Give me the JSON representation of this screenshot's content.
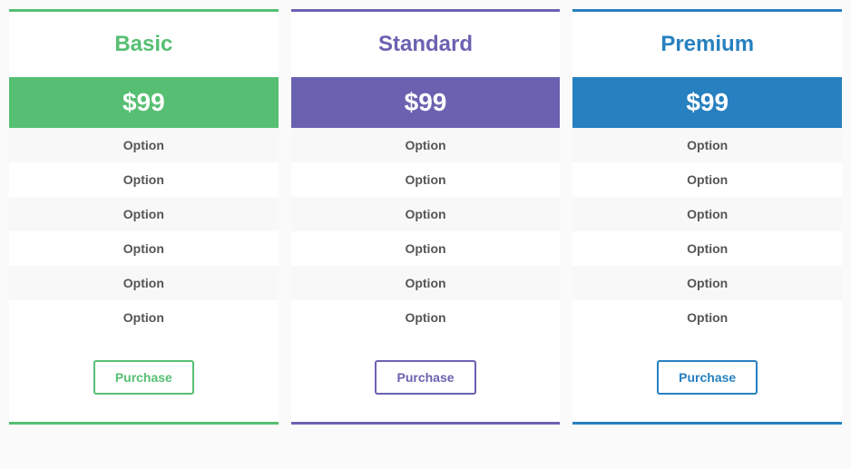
{
  "plans": [
    {
      "title": "Basic",
      "price": "$99",
      "options": [
        "Option",
        "Option",
        "Option",
        "Option",
        "Option",
        "Option"
      ],
      "cta": "Purchase"
    },
    {
      "title": "Standard",
      "price": "$99",
      "options": [
        "Option",
        "Option",
        "Option",
        "Option",
        "Option",
        "Option"
      ],
      "cta": "Purchase"
    },
    {
      "title": "Premium",
      "price": "$99",
      "options": [
        "Option",
        "Option",
        "Option",
        "Option",
        "Option",
        "Option"
      ],
      "cta": "Purchase"
    }
  ]
}
